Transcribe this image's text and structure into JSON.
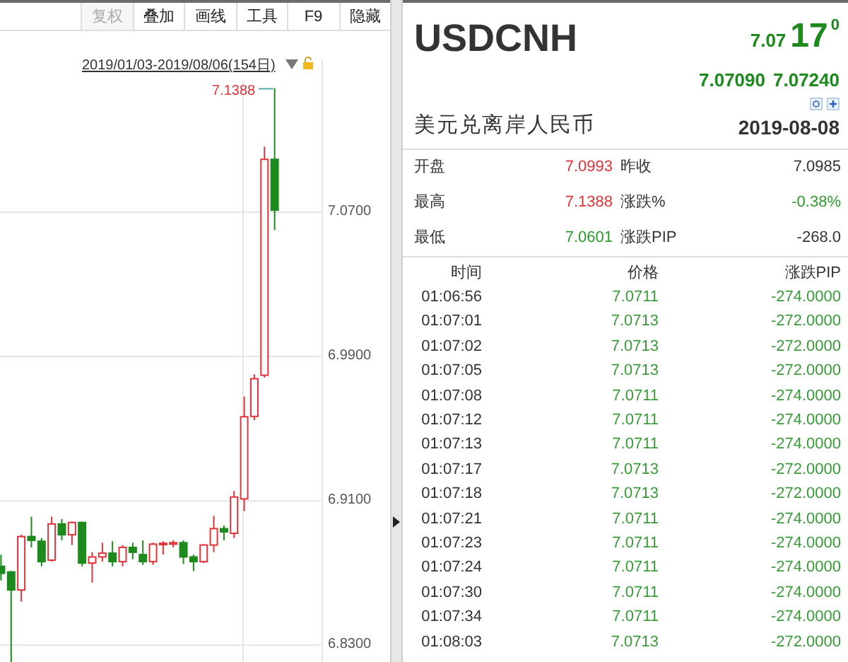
{
  "toolbar": [
    {
      "label": "复权",
      "disabled": true
    },
    {
      "label": "叠加",
      "disabled": false
    },
    {
      "label": "画线",
      "disabled": false
    },
    {
      "label": "工具",
      "disabled": false
    },
    {
      "label": "F9",
      "disabled": false
    },
    {
      "label": "隐藏",
      "disabled": false
    }
  ],
  "chart": {
    "date_range": "2019/01/03-2019/08/06(154日)",
    "high_label": "7.1388",
    "chart_data": {
      "type": "candlestick",
      "categories": [
        null,
        null,
        null,
        null,
        null,
        null,
        null,
        null,
        null,
        null,
        null,
        null,
        null,
        null,
        null,
        null,
        null,
        null,
        null,
        null,
        null,
        null,
        null,
        null,
        null,
        null,
        null,
        null
      ],
      "ylim": [
        6.8191,
        7.155
      ],
      "grid": true,
      "yticks": [
        {
          "value": 7.07,
          "label": "7.0700"
        },
        {
          "value": 6.99,
          "label": "6.9900"
        },
        {
          "value": 6.91,
          "label": "6.9100"
        },
        {
          "value": 6.83,
          "label": "6.8300"
        }
      ],
      "ohlc": [
        [
          6.8737,
          6.8802,
          6.8659,
          6.8698
        ],
        [
          6.8706,
          6.8711,
          6.8201,
          6.8606
        ],
        [
          6.8606,
          6.8912,
          6.8541,
          6.8902
        ],
        [
          6.8902,
          6.9012,
          6.8842,
          6.8881
        ],
        [
          6.8876,
          6.8894,
          6.8737,
          6.8763
        ],
        [
          6.8771,
          6.9012,
          6.8763,
          6.8972
        ],
        [
          6.8972,
          6.8999,
          6.8881,
          6.8912
        ],
        [
          6.8912,
          6.8985,
          6.8855,
          6.898
        ],
        [
          6.898,
          6.8985,
          6.8737,
          6.8755
        ],
        [
          6.8755,
          6.8815,
          6.8646,
          6.8789
        ],
        [
          6.8789,
          6.8868,
          6.8763,
          6.881
        ],
        [
          6.881,
          6.8876,
          6.8737,
          6.8763
        ],
        [
          6.8763,
          6.8855,
          6.8737,
          6.8842
        ],
        [
          6.8842,
          6.8868,
          6.8776,
          6.8815
        ],
        [
          6.8802,
          6.8881,
          6.8745,
          6.8763
        ],
        [
          6.8763,
          6.8868,
          6.8745,
          6.886
        ],
        [
          6.886,
          6.8876,
          6.8802,
          6.8865
        ],
        [
          6.886,
          6.8881,
          6.8842,
          6.8868
        ],
        [
          6.8868,
          6.8881,
          6.875,
          6.8789
        ],
        [
          6.8789,
          6.8802,
          6.8711,
          6.8763
        ],
        [
          6.8763,
          6.886,
          6.8755,
          6.8855
        ],
        [
          6.8855,
          6.9017,
          6.8815,
          6.8946
        ],
        [
          6.8946,
          6.8964,
          6.8881,
          6.8928
        ],
        [
          6.892,
          6.9155,
          6.8894,
          6.9121
        ],
        [
          6.9111,
          6.9678,
          6.9043,
          6.9566
        ],
        [
          6.9568,
          6.9801,
          6.9547,
          6.9777
        ],
        [
          6.9796,
          7.1064,
          6.9783,
          7.0993
        ],
        [
          7.0993,
          7.1388,
          7.0601,
          7.0711
        ]
      ]
    }
  },
  "quote": {
    "symbol": "USDCNH",
    "price_main": "7.07",
    "price_big": "17",
    "price_small": "0",
    "bid": "7.07090",
    "ask": "7.07240",
    "name": "美元兑离岸人民币",
    "date": "2019-08-08"
  },
  "stats": [
    {
      "label": "开盘",
      "value": "7.0993",
      "color": "#e0333a"
    },
    {
      "label": "昨收",
      "value": "7.0985",
      "color": "#333333"
    },
    {
      "label": "最高",
      "value": "7.1388",
      "color": "#e0333a"
    },
    {
      "label": "涨跌%",
      "value": "-0.38%",
      "color": "#2e9a2e"
    },
    {
      "label": "最低",
      "value": "7.0601",
      "color": "#2e9a2e"
    },
    {
      "label": "涨跌PIP",
      "value": "-268.0",
      "color": "#333333"
    }
  ],
  "ticks": {
    "columns": [
      "时间",
      "价格",
      "涨跌PIP"
    ],
    "rows": [
      {
        "time": "01:06:56",
        "price": "7.0711",
        "change": "-274.0000"
      },
      {
        "time": "01:07:01",
        "price": "7.0713",
        "change": "-272.0000"
      },
      {
        "time": "01:07:02",
        "price": "7.0713",
        "change": "-272.0000"
      },
      {
        "time": "01:07:05",
        "price": "7.0713",
        "change": "-272.0000"
      },
      {
        "time": "01:07:08",
        "price": "7.0711",
        "change": "-274.0000"
      },
      {
        "time": "01:07:12",
        "price": "7.0711",
        "change": "-274.0000"
      },
      {
        "time": "01:07:13",
        "price": "7.0711",
        "change": "-274.0000"
      },
      {
        "time": "01:07:17",
        "price": "7.0713",
        "change": "-272.0000"
      },
      {
        "time": "01:07:18",
        "price": "7.0713",
        "change": "-272.0000"
      },
      {
        "time": "01:07:21",
        "price": "7.0711",
        "change": "-274.0000"
      },
      {
        "time": "01:07:23",
        "price": "7.0711",
        "change": "-274.0000"
      },
      {
        "time": "01:07:24",
        "price": "7.0711",
        "change": "-274.0000"
      },
      {
        "time": "01:07:30",
        "price": "7.0711",
        "change": "-274.0000"
      },
      {
        "time": "01:07:34",
        "price": "7.0711",
        "change": "-274.0000"
      },
      {
        "time": "01:08:03",
        "price": "7.0713",
        "change": "-272.0000"
      }
    ]
  }
}
